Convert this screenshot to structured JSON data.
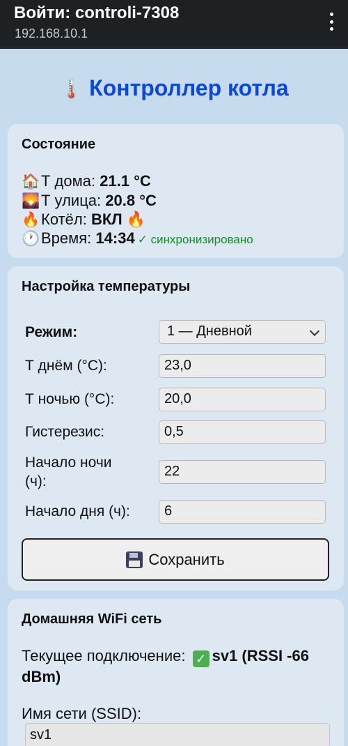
{
  "topbar": {
    "title": "Войти: controli-7308",
    "url": "192.168.10.1"
  },
  "header": {
    "icon": "🌡️",
    "title": "Контроллер котла"
  },
  "status": {
    "heading": "Состояние",
    "home_icon": "🏠",
    "home_label": "Т дома: ",
    "home_value": "21.1 °C",
    "outside_icon": "🌄",
    "outside_label": "Т улица: ",
    "outside_value": "20.8 °C",
    "boiler_icon": "🔥",
    "boiler_label": "Котёл: ",
    "boiler_value": "ВКЛ",
    "boiler_icon2": "🔥",
    "time_icon": "🕐",
    "time_label": "Время: ",
    "time_value": "14:34",
    "sync_text": "✓ синхронизировано"
  },
  "temps": {
    "heading": "Настройка температуры",
    "mode_label": "Режим:",
    "mode_value": "1 — Дневной",
    "day_label": "Т днём (°C):",
    "day_value": "23,0",
    "night_label": "Т ночью (°C):",
    "night_value": "20,0",
    "hyst_label": "Гистерезис:",
    "hyst_value": "0,5",
    "night_start_label_1": "Начало ночи",
    "night_start_label_2": "(ч):",
    "night_start_value": "22",
    "day_start_label": "Начало дня (ч):",
    "day_start_value": "6",
    "save_label": "Сохранить"
  },
  "wifi": {
    "heading": "Домашняя WiFi сеть",
    "current_label": "Текущее подключение: ",
    "current_value": "sv1 (RSSI -66 dBm)",
    "ssid_label": "Имя сети (SSID):",
    "ssid_value": "sv1"
  }
}
